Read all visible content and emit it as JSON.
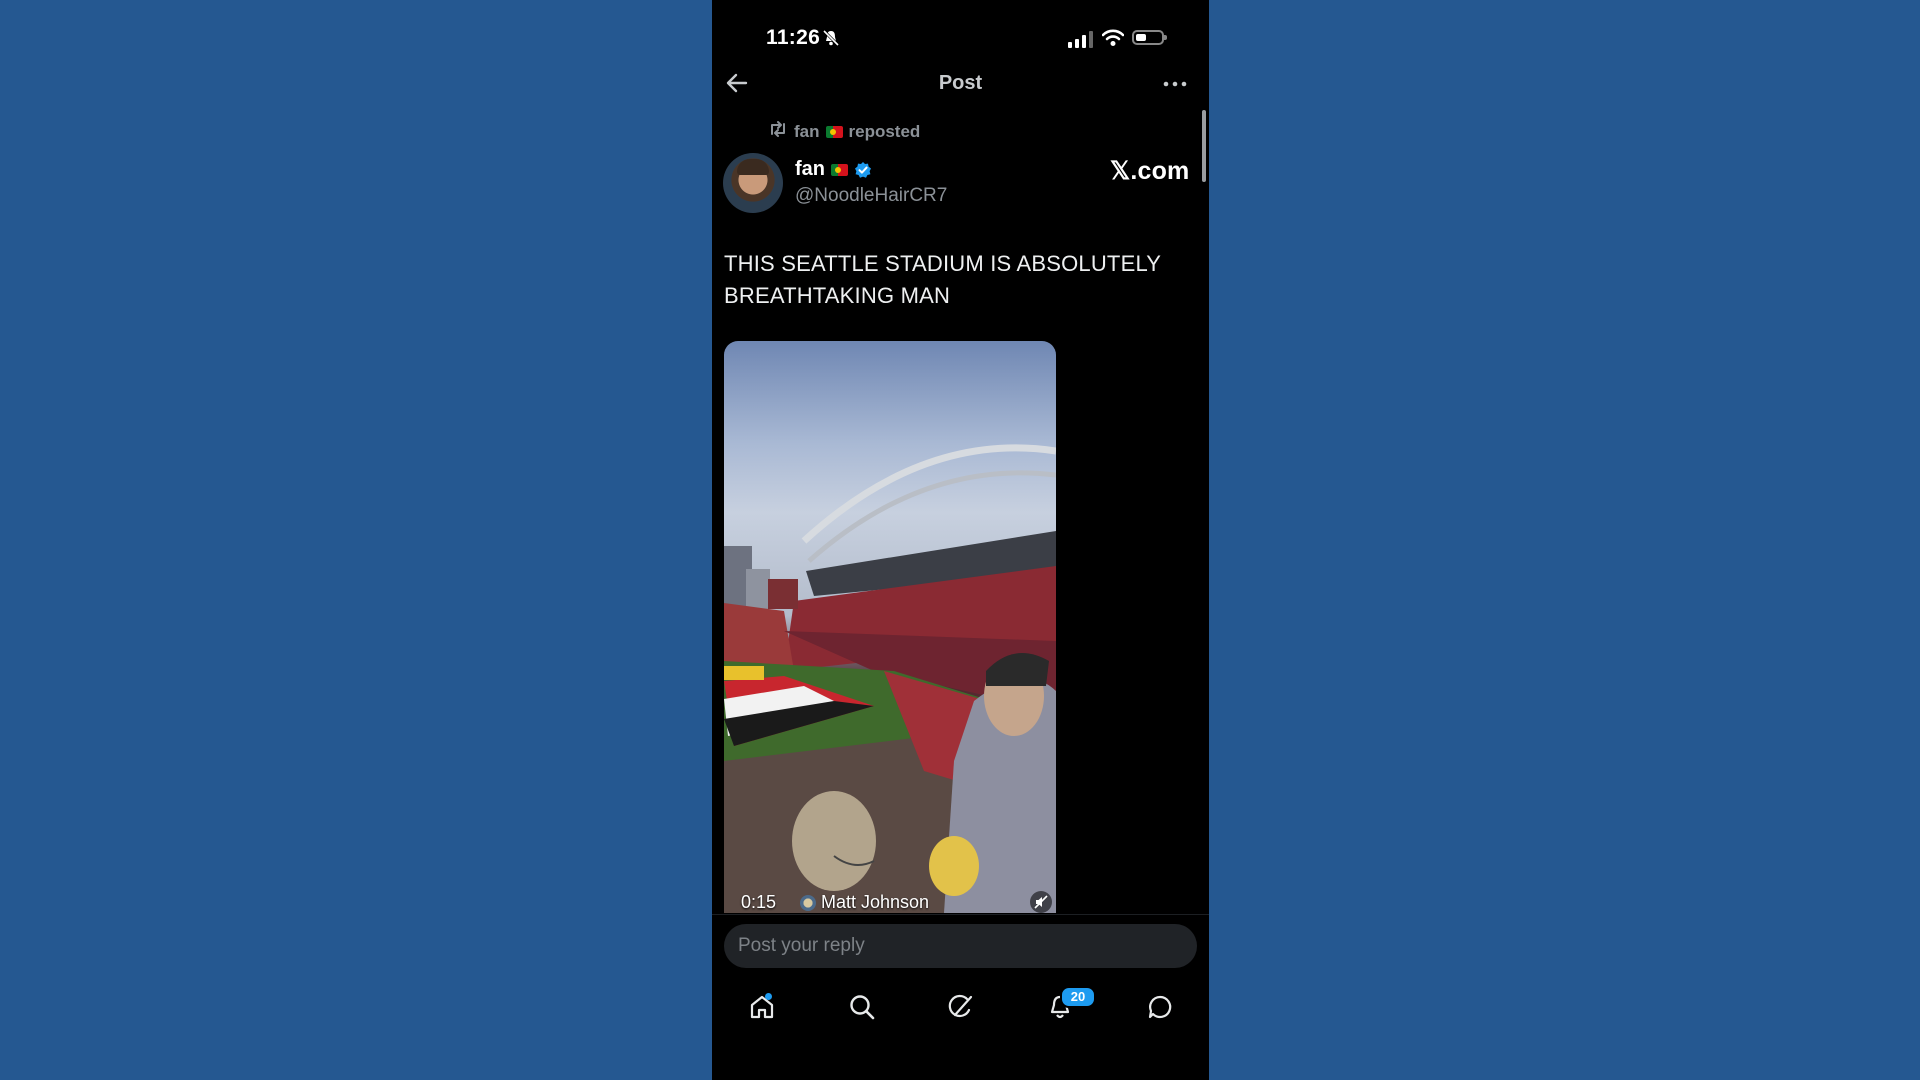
{
  "status_bar": {
    "time": "11:26",
    "icons": [
      "bell-off-icon",
      "signal-icon",
      "wifi-icon",
      "battery-icon"
    ]
  },
  "header": {
    "title": "Post",
    "back_icon": "back-arrow-icon",
    "more_icon": "more-icon"
  },
  "repost": {
    "user": "fan",
    "label": "reposted",
    "icon": "repost-icon"
  },
  "author": {
    "name": "fan",
    "handle": "@NoodleHairCR7",
    "verified": true,
    "watermark": "𝕏.com"
  },
  "post": {
    "text": "THIS SEATTLE STADIUM IS ABSOLUTELY BREATHTAKING MAN"
  },
  "media": {
    "duration": "0:15",
    "credit": "Matt Johnson",
    "mute_icon": "muted-speaker-icon"
  },
  "reply": {
    "placeholder": "Post your reply"
  },
  "tabbar": {
    "items": [
      "home-icon",
      "search-icon",
      "grok-icon",
      "notifications-icon",
      "messages-icon"
    ],
    "notification_count": "20"
  },
  "colors": {
    "background": "#255891",
    "app_bg": "#000000",
    "accent": "#1d9bf0",
    "muted_text": "#8b9197"
  }
}
